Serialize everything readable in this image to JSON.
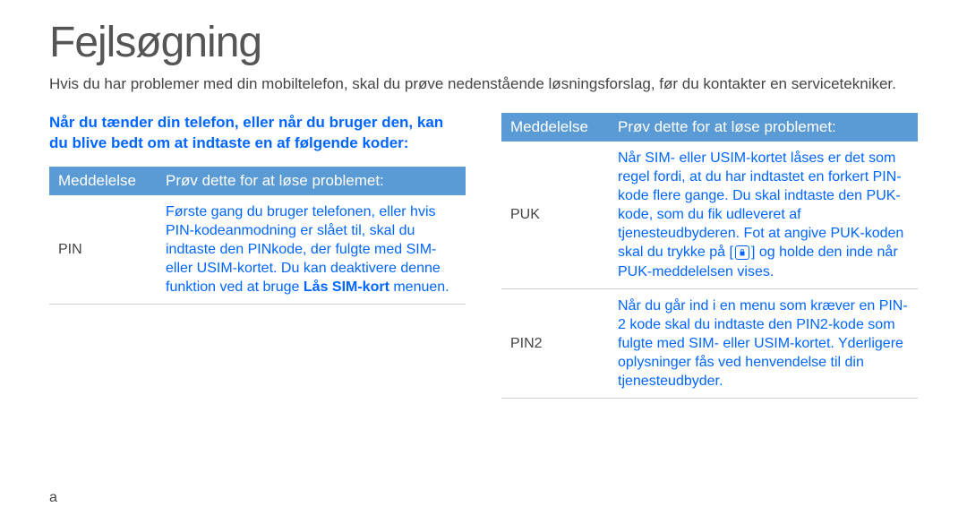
{
  "title": "Fejlsøgning",
  "intro": "Hvis du har problemer med din mobiltelefon, skal du prøve nedenstående løsningsforslag, før du kontakter en servicetekniker.",
  "left": {
    "heading": "Når du tænder din telefon, eller når du bruger den, kan du blive bedt om at indtaste en af følgende koder:",
    "headers": {
      "col1": "Meddelelse",
      "col2": "Prøv dette for at løse problemet:"
    },
    "rows": [
      {
        "label": "PIN",
        "text_pre": "Første gang du bruger telefonen, eller hvis PIN-kodeanmodning er slået til, skal du indtaste den PINkode, der fulgte med SIM- eller USIM-kortet. Du kan deaktivere denne funktion ved at bruge ",
        "bold1": "Lås SIM-kort",
        "text_post": " menuen."
      }
    ]
  },
  "right": {
    "headers": {
      "col1": "Meddelelse",
      "col2": "Prøv dette for at løse problemet:"
    },
    "rows": [
      {
        "label": "PUK",
        "text_pre": "Når SIM- eller USIM-kortet låses er det som regel fordi, at du har indtastet en forkert PIN-kode flere gange. Du skal indtaste den PUK-kode, som du fik udleveret af tjenesteudbyderen. Fot at angive PUK-koden skal du trykke på [",
        "text_post": "] og holde den inde når PUK-meddelelsen vises."
      },
      {
        "label": "PIN2",
        "text": "Når du går ind i en menu som kræver en PIN-2 kode skal du indtaste den PIN2-kode som fulgte med SIM- eller USIM-kortet. Yderligere oplysninger fås ved henvendelse til din tjenesteudbyder."
      }
    ]
  },
  "page_marker": "a"
}
